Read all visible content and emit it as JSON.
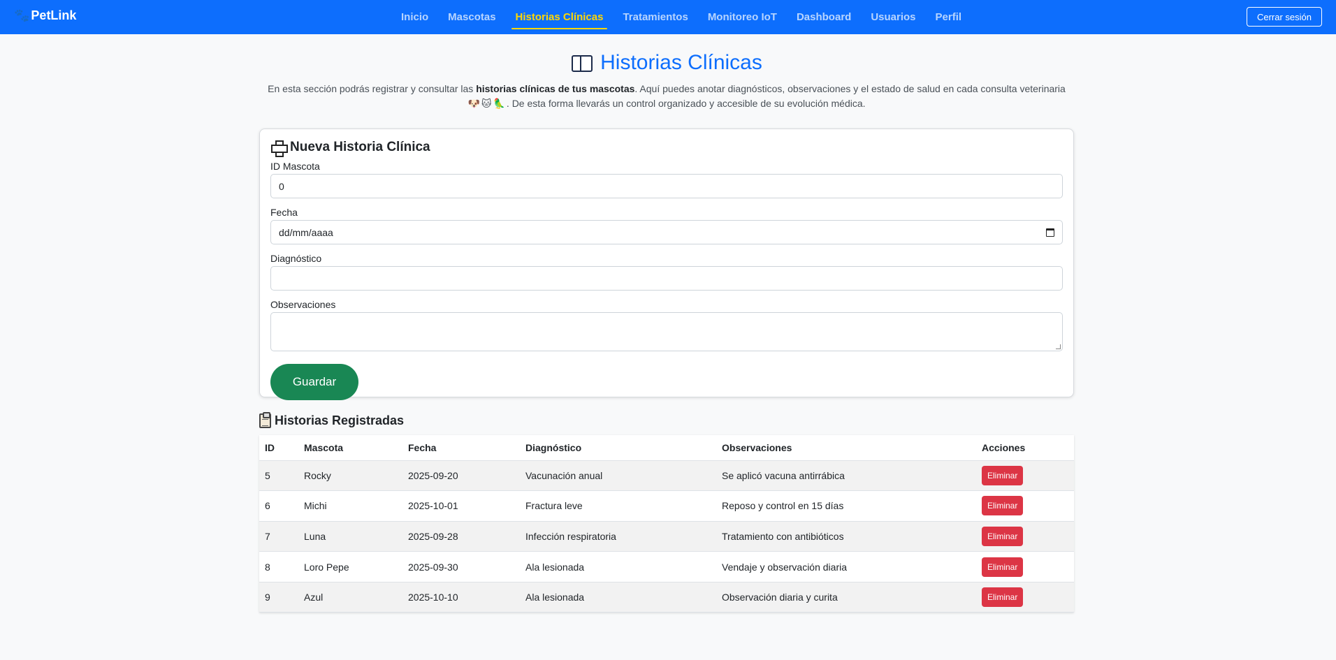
{
  "nav": {
    "brand": "PetLink",
    "links": [
      "Inicio",
      "Mascotas",
      "Historias Clínicas",
      "Tratamientos",
      "Monitoreo IoT",
      "Dashboard",
      "Usuarios",
      "Perfil"
    ],
    "active": "Historias Clínicas",
    "logout": "Cerrar sesión"
  },
  "header": {
    "title": "Historias Clínicas",
    "intro_1": "En esta sección podrás registrar y consultar las ",
    "intro_bold": "historias clínicas de tus mascotas",
    "intro_2": ". Aquí puedes anotar diagnósticos, observaciones y el estado de salud en cada consulta veterinaria ",
    "intro_pets": "🐶🐱🦜",
    "intro_3": ". De esta forma llevarás un control organizado y accesible de su evolución médica."
  },
  "form": {
    "title": "Nueva Historia Clínica",
    "id_label": "ID Mascota",
    "id_value": "0",
    "date_label": "Fecha",
    "date_placeholder": "dd/mm/aaaa",
    "diag_label": "Diagnóstico",
    "diag_value": "",
    "obs_label": "Observaciones",
    "obs_value": "",
    "save": "Guardar"
  },
  "records": {
    "title": "Historias Registradas",
    "columns": [
      "ID",
      "Mascota",
      "Fecha",
      "Diagnóstico",
      "Observaciones",
      "Acciones"
    ],
    "delete_label": "Eliminar",
    "rows": [
      {
        "id": "5",
        "pet": "Rocky",
        "date": "2025-09-20",
        "diagnosis": "Vacunación anual",
        "notes": "Se aplicó vacuna antirrábica"
      },
      {
        "id": "6",
        "pet": "Michi",
        "date": "2025-10-01",
        "diagnosis": "Fractura leve",
        "notes": "Reposo y control en 15 días"
      },
      {
        "id": "7",
        "pet": "Luna",
        "date": "2025-09-28",
        "diagnosis": "Infección respiratoria",
        "notes": "Tratamiento con antibióticos"
      },
      {
        "id": "8",
        "pet": "Loro Pepe",
        "date": "2025-09-30",
        "diagnosis": "Ala lesionada",
        "notes": "Vendaje y observación diaria"
      },
      {
        "id": "9",
        "pet": "Azul",
        "date": "2025-10-10",
        "diagnosis": "Ala lesionada",
        "notes": "Observación diaria y curita"
      }
    ]
  },
  "colors": {
    "primary": "#0d6efd",
    "active_link": "#ffd700",
    "save": "#198754",
    "delete": "#dc3545"
  }
}
